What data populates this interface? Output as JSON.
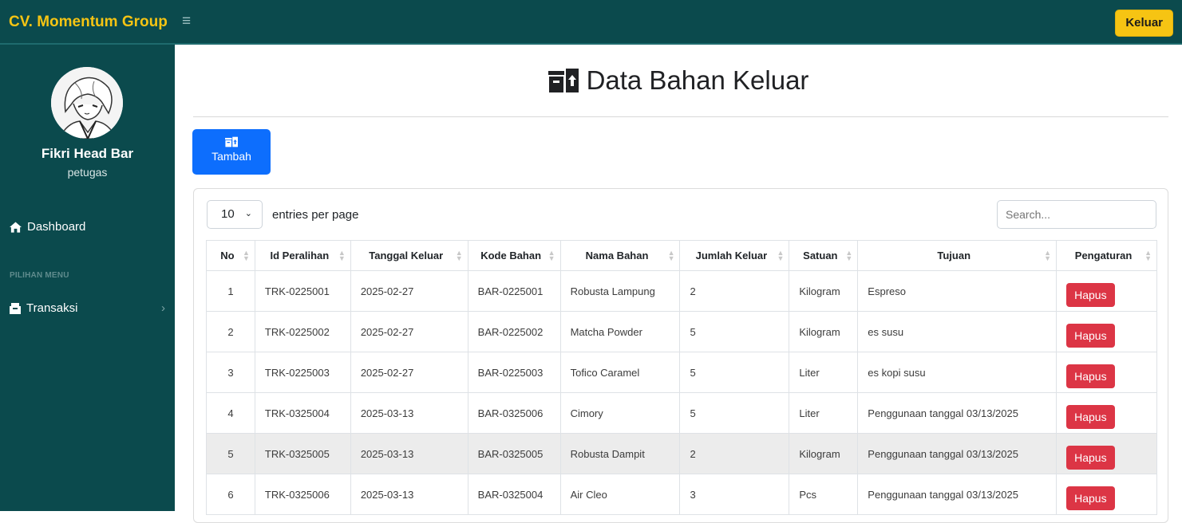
{
  "header": {
    "brand": "CV. Momentum Group",
    "menu_icon": "hamburger-icon",
    "logout_label": "Keluar"
  },
  "sidebar": {
    "user_name": "Fikri Head Bar",
    "user_role": "petugas",
    "dashboard_label": "Dashboard",
    "menu_heading": "PILIHAN MENU",
    "transaksi_label": "Transaksi"
  },
  "page": {
    "title": "Data Bahan Keluar",
    "add_label": "Tambah"
  },
  "table_controls": {
    "page_length": "10",
    "length_label": "entries per page",
    "search_placeholder": "Search..."
  },
  "columns": [
    "No",
    "Id Peralihan",
    "Tanggal Keluar",
    "Kode Bahan",
    "Nama Bahan",
    "Jumlah Keluar",
    "Satuan",
    "Tujuan",
    "Pengaturan"
  ],
  "rows": [
    {
      "no": "1",
      "id": "TRK-0225001",
      "tanggal": "2025-02-27",
      "kode": "BAR-0225001",
      "nama": "Robusta Lampung",
      "jumlah": "2",
      "satuan": "Kilogram",
      "tujuan": "Espreso",
      "action": "Hapus"
    },
    {
      "no": "2",
      "id": "TRK-0225002",
      "tanggal": "2025-02-27",
      "kode": "BAR-0225002",
      "nama": "Matcha Powder",
      "jumlah": "5",
      "satuan": "Kilogram",
      "tujuan": "es susu",
      "action": "Hapus"
    },
    {
      "no": "3",
      "id": "TRK-0225003",
      "tanggal": "2025-02-27",
      "kode": "BAR-0225003",
      "nama": "Tofico Caramel",
      "jumlah": "5",
      "satuan": "Liter",
      "tujuan": "es kopi susu",
      "action": "Hapus"
    },
    {
      "no": "4",
      "id": "TRK-0325004",
      "tanggal": "2025-03-13",
      "kode": "BAR-0325006",
      "nama": "Cimory",
      "jumlah": "5",
      "satuan": "Liter",
      "tujuan": "Penggunaan tanggal 03/13/2025",
      "action": "Hapus"
    },
    {
      "no": "5",
      "id": "TRK-0325005",
      "tanggal": "2025-03-13",
      "kode": "BAR-0325005",
      "nama": "Robusta Dampit",
      "jumlah": "2",
      "satuan": "Kilogram",
      "tujuan": "Penggunaan tanggal 03/13/2025",
      "action": "Hapus"
    },
    {
      "no": "6",
      "id": "TRK-0325006",
      "tanggal": "2025-03-13",
      "kode": "BAR-0325004",
      "nama": "Air Cleo",
      "jumlah": "3",
      "satuan": "Pcs",
      "tujuan": "Penggunaan tanggal 03/13/2025",
      "action": "Hapus"
    }
  ],
  "colors": {
    "sidebar": "#0b4a4d",
    "brand": "#f6c413",
    "primary": "#0d6efd",
    "danger": "#dc3545"
  }
}
